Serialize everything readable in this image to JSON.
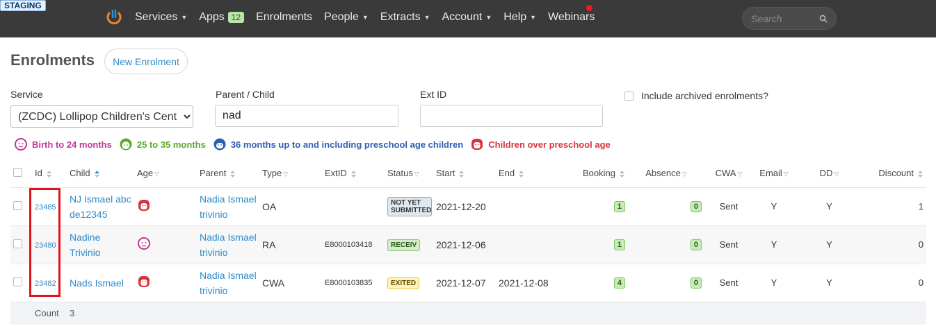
{
  "env_badge": "STAGING",
  "nav": {
    "items": [
      {
        "label": "Services",
        "dropdown": true
      },
      {
        "label": "Apps",
        "badge": "12",
        "dropdown": false
      },
      {
        "label": "Enrolments",
        "dropdown": false
      },
      {
        "label": "People",
        "dropdown": true
      },
      {
        "label": "Extracts",
        "dropdown": true
      },
      {
        "label": "Account",
        "dropdown": true
      },
      {
        "label": "Help",
        "dropdown": true
      },
      {
        "label": "Webinars",
        "dropdown": false
      }
    ],
    "search_placeholder": "Search"
  },
  "header": {
    "title": "Enrolments",
    "new_button": "New Enrolment"
  },
  "filters": {
    "service_label": "Service",
    "service_value": "(ZCDC) Lollipop Children's Cent",
    "parent_child_label": "Parent / Child",
    "parent_child_value": "nad",
    "ext_id_label": "Ext ID",
    "ext_id_value": "",
    "archived_label": "Include archived enrolments?"
  },
  "legend": [
    {
      "label": "Birth to 24 months",
      "color": "#c2349a"
    },
    {
      "label": "25 to 35 months",
      "color": "#56a92c"
    },
    {
      "label": "36 months up to and including preschool age children",
      "color": "#2b5fb3"
    },
    {
      "label": "Children over preschool age",
      "color": "#d8343e"
    }
  ],
  "table": {
    "headers": {
      "id": "Id",
      "child": "Child",
      "age": "Age",
      "parent": "Parent",
      "type": "Type",
      "extid": "ExtID",
      "status": "Status",
      "start": "Start",
      "end": "End",
      "booking": "Booking",
      "absence": "Absence",
      "cwa": "CWA",
      "email": "Email",
      "dd": "DD",
      "discount": "Discount"
    },
    "rows": [
      {
        "id": "23485",
        "child": "NJ Ismael abc de12345",
        "age_icon": "over-preschool-icon",
        "parent": "Nadia Ismael trivinio",
        "type": "OA",
        "extid": "",
        "status": "NOT YET SUBMITTED",
        "start": "2021-12-20",
        "end": "",
        "booking": "1",
        "absence": "0",
        "cwa": "Sent",
        "email": "Y",
        "dd": "Y",
        "discount": "1"
      },
      {
        "id": "23480",
        "child": "Nadine Trivinio",
        "age_icon": "birth-to-24-icon",
        "parent": "Nadia Ismael trivinio",
        "type": "RA",
        "extid": "E8000103418",
        "status": "RECEIV",
        "start": "2021-12-06",
        "end": "",
        "booking": "1",
        "absence": "0",
        "cwa": "Sent",
        "email": "Y",
        "dd": "Y",
        "discount": "0"
      },
      {
        "id": "23482",
        "child": "Nads Ismael",
        "age_icon": "over-preschool-icon",
        "parent": "Nadia Ismael trivinio",
        "type": "CWA",
        "extid": "E8000103835",
        "status": "EXITED",
        "start": "2021-12-07",
        "end": "2021-12-08",
        "booking": "4",
        "absence": "0",
        "cwa": "Sent",
        "email": "Y",
        "dd": "Y",
        "discount": "0"
      }
    ],
    "count_label": "Count",
    "count_value": "3"
  }
}
